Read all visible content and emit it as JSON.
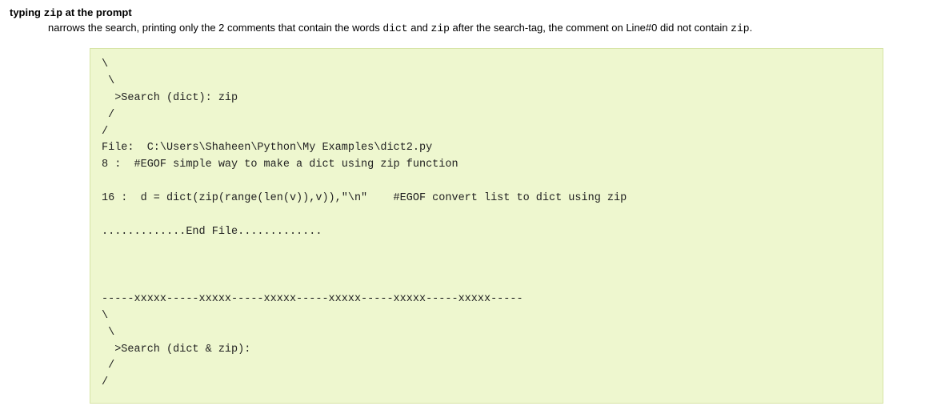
{
  "heading": {
    "prefix": "typing ",
    "code": "zip",
    "suffix": " at the prompt"
  },
  "description": {
    "part1": "narrows the search, printing only the 2 comments that contain the words ",
    "code1": "dict",
    "part2": " and ",
    "code2": "zip",
    "part3": " after the search-tag, the comment on Line#0 did not contain ",
    "code3": "zip",
    "part4": "."
  },
  "code": {
    "full": "\\\n \\\n  >Search (dict): zip\n /\n/\nFile:  C:\\Users\\Shaheen\\Python\\My Examples\\dict2.py\n8 :  #EGOF simple way to make a dict using zip function\n\n16 :  d = dict(zip(range(len(v)),v)),\"\\n\"    #EGOF convert list to dict using zip\n\n.............End File.............\n\n\n\n-----xxxxx-----xxxxx-----xxxxx-----xxxxx-----xxxxx-----xxxxx-----\n\\\n \\\n  >Search (dict & zip):\n /\n/"
  }
}
